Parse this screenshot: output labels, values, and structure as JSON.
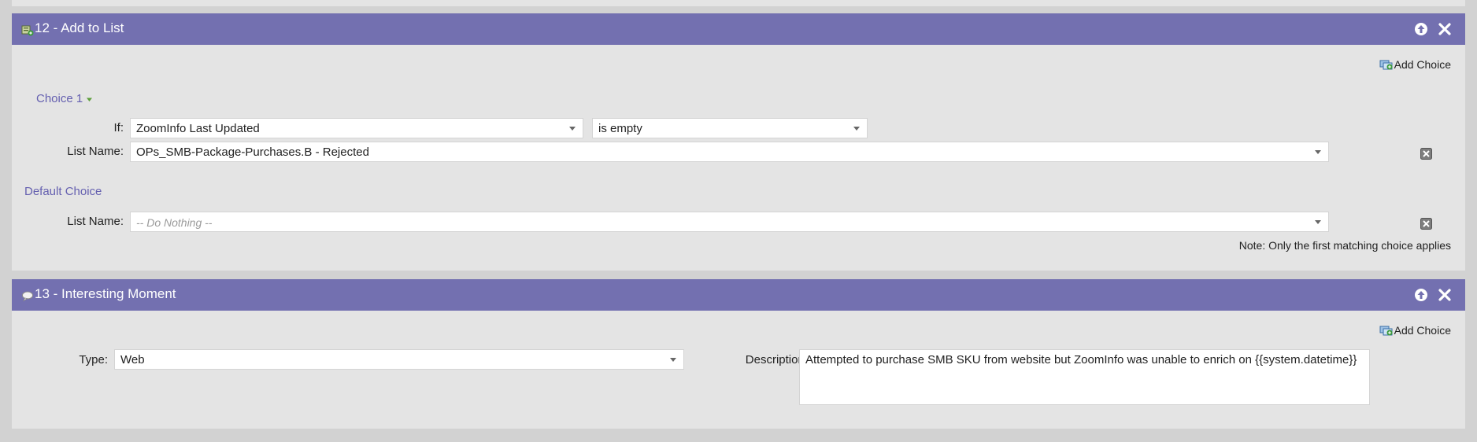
{
  "flow_steps": [
    {
      "title": "12 - Add to List",
      "header_icon": "list-add-icon",
      "add_choice_label": "Add Choice",
      "choice": {
        "label": "Choice 1",
        "if_label": "If:",
        "condition_field": "ZoomInfo Last Updated",
        "condition_operator": "is empty",
        "list_name_label": "List Name:",
        "list_name_value": "OPs_SMB-Package-Purchases.B - Rejected"
      },
      "default_choice": {
        "label": "Default Choice",
        "list_name_label": "List Name:",
        "list_name_placeholder": "-- Do Nothing --"
      },
      "note": "Note: Only the first matching choice applies"
    },
    {
      "title": "13 - Interesting Moment",
      "header_icon": "speech-bubble-icon",
      "add_choice_label": "Add Choice",
      "type_label": "Type:",
      "type_value": "Web",
      "description_label": "Description:",
      "description_value": "Attempted to purchase SMB SKU from website but ZoomInfo was unable to enrich on {{system.datetime}}"
    }
  ],
  "colors": {
    "header_bg": "#7370b0",
    "panel_bg": "#e4e4e4",
    "page_bg": "#d2d2d2",
    "choice_label": "#6560b0"
  }
}
